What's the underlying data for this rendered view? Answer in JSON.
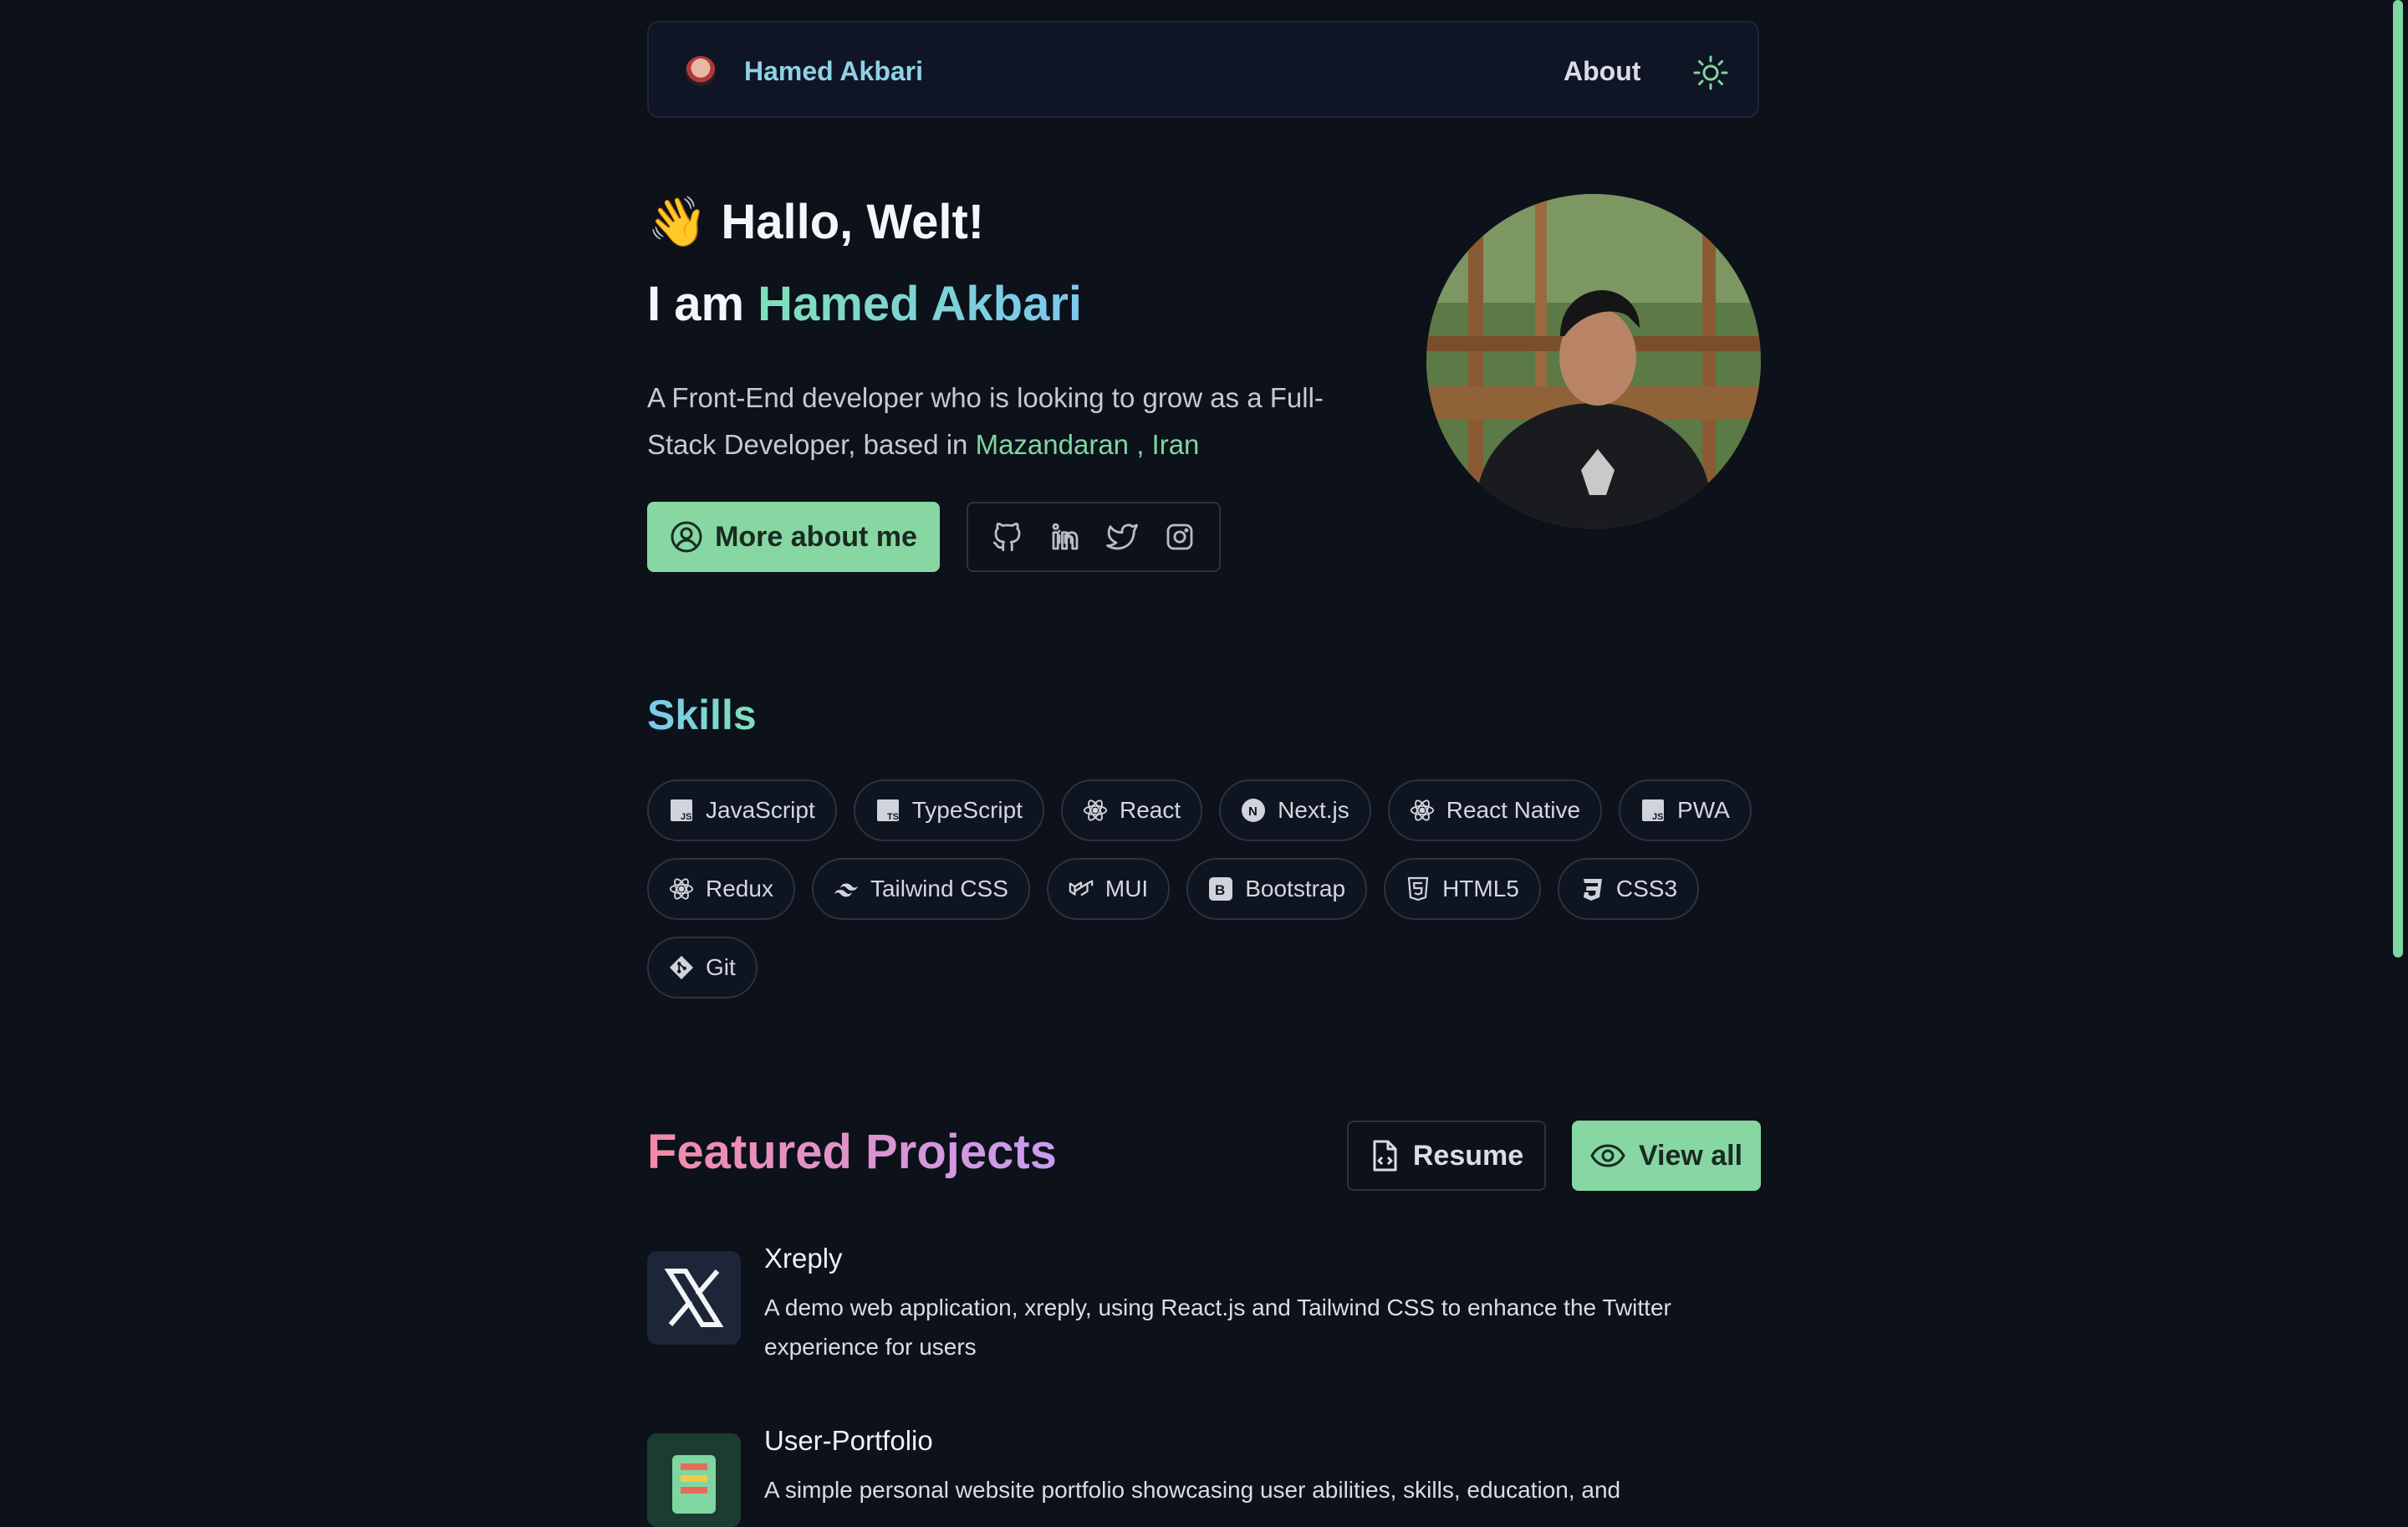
{
  "header": {
    "brand": "Hamed Akbari",
    "nav_about": "About",
    "theme_toggle_icon": "sun-icon"
  },
  "hero": {
    "greeting_emoji": "👋",
    "greeting": "Hallo, Welt!",
    "iam_prefix": "I am ",
    "name": "Hamed Akbari",
    "bio": "A Front-End developer who is looking to grow as a Full-Stack Developer, based in ",
    "location": "Mazandaran , Iran",
    "more_button": "More about me",
    "socials": [
      "github-icon",
      "linkedin-icon",
      "twitter-icon",
      "instagram-icon"
    ]
  },
  "skills": {
    "title": "Skills",
    "items": [
      {
        "label": "JavaScript",
        "icon": "javascript-icon"
      },
      {
        "label": "TypeScript",
        "icon": "typescript-icon"
      },
      {
        "label": "React",
        "icon": "react-icon"
      },
      {
        "label": "Next.js",
        "icon": "nextjs-icon"
      },
      {
        "label": "React Native",
        "icon": "react-icon"
      },
      {
        "label": "PWA",
        "icon": "javascript-icon"
      },
      {
        "label": "Redux",
        "icon": "react-icon"
      },
      {
        "label": "Tailwind CSS",
        "icon": "tailwind-icon"
      },
      {
        "label": "MUI",
        "icon": "mui-icon"
      },
      {
        "label": "Bootstrap",
        "icon": "bootstrap-icon"
      },
      {
        "label": "HTML5",
        "icon": "html5-icon"
      },
      {
        "label": "CSS3",
        "icon": "css3-icon"
      },
      {
        "label": "Git",
        "icon": "git-icon"
      }
    ]
  },
  "projects": {
    "title": "Featured Projects",
    "resume_button": "Resume",
    "view_all_button": "View all",
    "items": [
      {
        "name": "Xreply",
        "description": "A demo web application, xreply, using React.js and Tailwind CSS to enhance the Twitter experience for users"
      },
      {
        "name": "User-Portfolio",
        "description": "A simple personal website portfolio showcasing user abilities, skills, education, and"
      }
    ]
  },
  "colors": {
    "background": "#0c111a",
    "accent_green": "#86d7a1",
    "accent_blue": "#7cc7f0",
    "accent_pink": "#f48aa8"
  }
}
